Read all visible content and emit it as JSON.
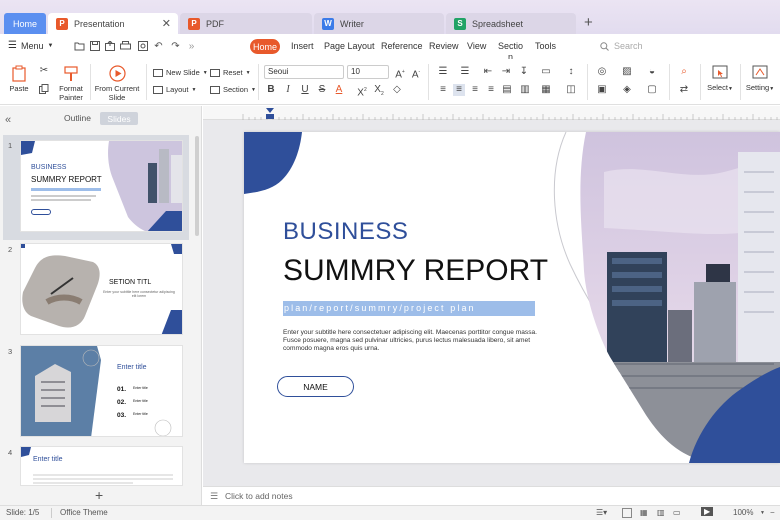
{
  "tabs": {
    "home": "Home",
    "items": [
      {
        "label": "Presentation",
        "badge": "P",
        "color": "#e8592b"
      },
      {
        "label": "PDF",
        "badge": "P",
        "color": "#e8592b"
      },
      {
        "label": "Writer",
        "badge": "W",
        "color": "#3b7be8"
      },
      {
        "label": "Spreadsheet",
        "badge": "S",
        "color": "#21a366"
      }
    ]
  },
  "menubar": {
    "menu_label": "Menu",
    "tabs": [
      "Home",
      "Insert",
      "Page Layout",
      "Reference",
      "Review",
      "View",
      "Sectio",
      "Tools"
    ],
    "tab_wrap": "n",
    "search_placeholder": "Search"
  },
  "ribbon": {
    "paste": "Paste",
    "format_painter_1": "Format",
    "format_painter_2": "Painter",
    "from_current_1": "From Current",
    "from_current_2": "Slide",
    "new_slide": "New Slide",
    "layout": "Layout",
    "reset": "Reset",
    "section": "Section",
    "font": "Seoui",
    "size": "10",
    "select": "Select",
    "setting": "Setting"
  },
  "panel": {
    "outline": "Outline",
    "slides": "Slides",
    "thumb_numbers": [
      "1",
      "2",
      "3",
      "4"
    ],
    "thumb1": {
      "line1": "BUSINESS",
      "line2": "SUMMRY REPORT"
    },
    "thumb2": {
      "title": "SETION TITL",
      "body": "Enter your subtitle here consectetur adipiscing elit lorem"
    },
    "thumb3": {
      "title": "Enter title",
      "items": [
        "01.",
        "02.",
        "03."
      ],
      "item_title": "Enter title"
    },
    "thumb4": {
      "title": "Enter title"
    }
  },
  "slide": {
    "line1": "BUSINESS",
    "line2": "SUMMRY REPORT",
    "tagline": "plan/report/summry/project plan",
    "body": "Enter your subtitle here consectetuer adipiscing elit. Maecenas porttitor congue massa. Fusce posuere, magna sed pulvinar ultricies, purus lectus malesuada libero, sit amet commodo magna eros quis urna.",
    "name_button": "NAME"
  },
  "notes": {
    "placeholder": "Click to add notes"
  },
  "status": {
    "slide": "Slide: 1/5",
    "theme": "Office Theme",
    "zoom": "100%"
  },
  "colors": {
    "accent": "#2f4f9a",
    "orange": "#e8592b",
    "tagline_bg": "#9dbde9"
  }
}
